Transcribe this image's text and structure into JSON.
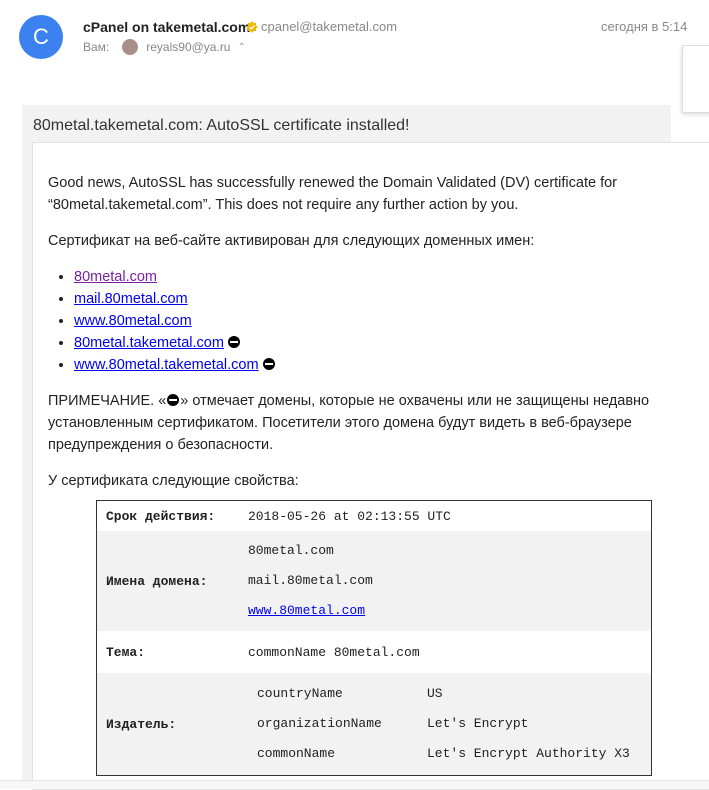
{
  "header": {
    "avatar_letter": "C",
    "sender_name": "cPanel on takemetal.com",
    "sender_email": "cpanel@takemetal.com",
    "date": "сегодня в 5:14",
    "to_label": "Вам:",
    "to_email": "reyals90@ya.ru"
  },
  "message": {
    "subject": "80metal.takemetal.com: AutoSSL certificate installed!",
    "intro": "Good news, AutoSSL has successfully renewed the Domain Validated (DV) certificate for “80metal.takemetal.com”. This does not require any further action by you.",
    "cert_intro": "Сертификат на веб-сайте активирован для следующих доменных имен:",
    "domains": [
      {
        "text": "80metal.com"
      },
      {
        "text": "mail.80metal.com"
      },
      {
        "text": "www.80metal.com"
      },
      {
        "text": "80metal.takemetal.com"
      },
      {
        "text": "www.80metal.takemetal.com"
      }
    ],
    "note_prefix": "ПРИМЕЧАНИЕ. «",
    "note_suffix": "» отмечает домены, которые не охвачены или не защищены недавно установленным сертификатом. Посетители этого домена будут видеть в веб-браузере предупреждения о безопасности.",
    "props_intro": "У сертификата следующие свойства:"
  },
  "properties": {
    "validity_label": "Срок действия:",
    "validity_value": "2018-05-26 at 02:13:55 UTC",
    "domains_label": "Имена домена:",
    "domain_names": [
      "80metal.com",
      "mail.80metal.com",
      "www.80metal.com"
    ],
    "subject_label": "Тема:",
    "subject_key": "commonName",
    "subject_value": "80metal.com",
    "issuer_label": "Издатель:",
    "issuer": [
      {
        "k": "countryName",
        "v": "US"
      },
      {
        "k": "organizationName",
        "v": "Let's Encrypt"
      },
      {
        "k": "commonName",
        "v": "Let's Encrypt Authority X3"
      }
    ]
  }
}
